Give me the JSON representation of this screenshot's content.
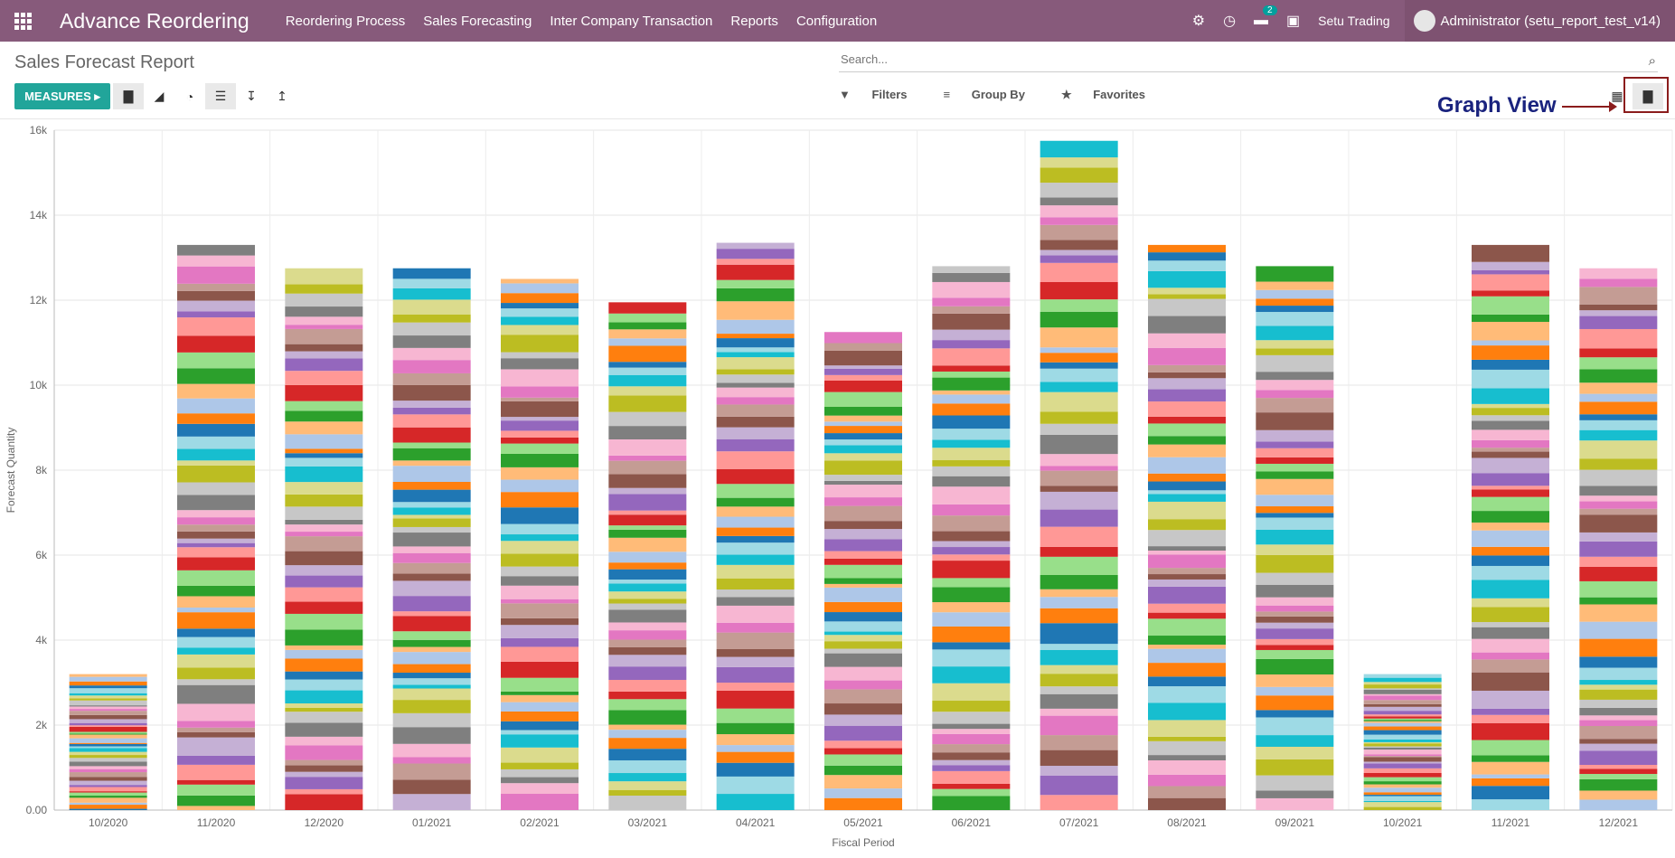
{
  "app": {
    "name": "Advance Reordering",
    "menu": [
      "Reordering Process",
      "Sales Forecasting",
      "Inter Company Transaction",
      "Reports",
      "Configuration"
    ],
    "message_count": "2",
    "company": "Setu Trading",
    "user": "Administrator (setu_report_test_v14)"
  },
  "page": {
    "title": "Sales Forecast Report",
    "measures_label": "MEASURES",
    "search_placeholder": "Search...",
    "filters": "Filters",
    "group_by": "Group By",
    "favorites": "Favorites",
    "annotation": "Graph View"
  },
  "icons": [
    "apps-icon",
    "bug-icon",
    "clock-icon",
    "chat-icon",
    "gift-icon",
    "bar-chart-icon",
    "line-chart-icon",
    "pie-chart-icon",
    "stack-icon",
    "sort-desc-icon",
    "sort-asc-icon",
    "search-icon",
    "filter-icon",
    "group-icon",
    "star-icon",
    "table-icon"
  ],
  "colors": {
    "topbar": "#875a7b",
    "measures": "#21a59a",
    "annotation": "#1a237e",
    "highlight": "#8b1c1c"
  },
  "chart_data": {
    "type": "bar",
    "stacked": true,
    "categories": [
      "10/2020",
      "11/2020",
      "12/2020",
      "01/2021",
      "02/2021",
      "03/2021",
      "04/2021",
      "05/2021",
      "06/2021",
      "07/2021",
      "08/2021",
      "09/2021",
      "10/2021",
      "11/2021",
      "12/2021"
    ],
    "values": [
      3200,
      13300,
      12750,
      12750,
      12500,
      11950,
      13350,
      11250,
      12800,
      15750,
      13300,
      12800,
      3200,
      13300,
      12750
    ],
    "xlabel": "Fiscal Period",
    "ylabel": "Forecast Quantity",
    "ylim": [
      0,
      16000
    ],
    "yticks": [
      "0.00",
      "2k",
      "4k",
      "6k",
      "8k",
      "10k",
      "12k",
      "14k",
      "16k"
    ],
    "grid": true,
    "segment_colors": [
      "#1f77b4",
      "#ff7f0e",
      "#aec7e8",
      "#ffbb78",
      "#2ca02c",
      "#98df8a",
      "#d62728",
      "#ff9896",
      "#9467bd",
      "#c5b0d5",
      "#8c564b",
      "#c49c94",
      "#e377c2",
      "#f7b6d2",
      "#7f7f7f",
      "#c7c7c7",
      "#bcbd22",
      "#dbdb8d",
      "#17becf",
      "#9edae5"
    ]
  }
}
